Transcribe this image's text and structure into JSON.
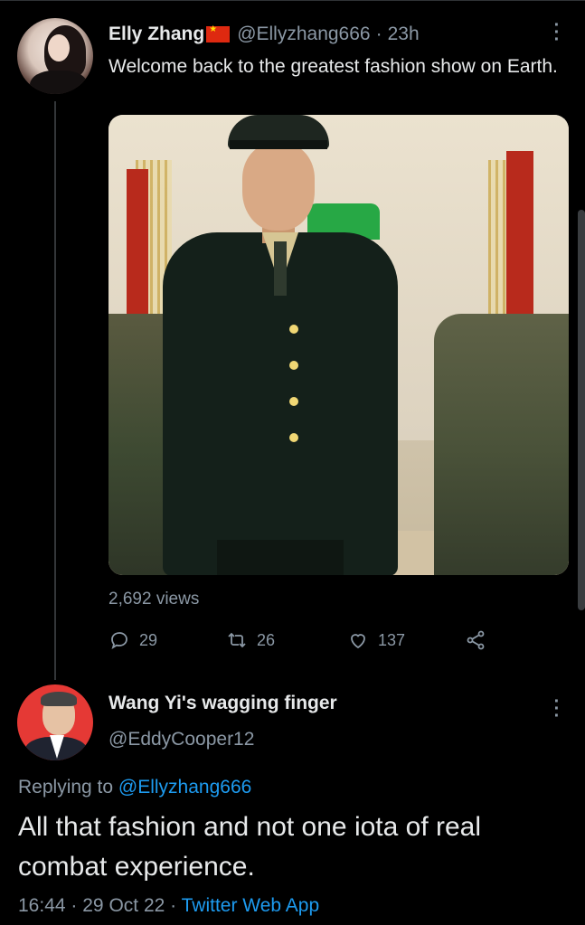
{
  "tweet": {
    "author_name": "Elly Zhang",
    "author_flag": "china-flag",
    "handle": "@Ellyzhang666",
    "separator": "·",
    "time": "23h",
    "text": "Welcome back to the greatest fashion show on Earth.",
    "views": "2,692 views",
    "actions": {
      "replies": "29",
      "retweets": "26",
      "likes": "137"
    }
  },
  "reply": {
    "author_name": "Wang Yi's wagging finger",
    "handle": "@EddyCooper12",
    "replying_prefix": "Replying to",
    "replying_handle": "@Ellyzhang666",
    "text": "All that fashion and not one iota of real combat experience.",
    "time": "16:44",
    "separator": "·",
    "date": "29 Oct 22",
    "source": "Twitter Web App"
  },
  "icons": {
    "more": "more-vertical-icon",
    "reply": "reply-icon",
    "retweet": "retweet-icon",
    "like": "heart-icon",
    "share": "share-icon"
  },
  "colors": {
    "background": "#000000",
    "text": "#e7e9ea",
    "muted": "#8b98a5",
    "link": "#1d9bf0"
  }
}
